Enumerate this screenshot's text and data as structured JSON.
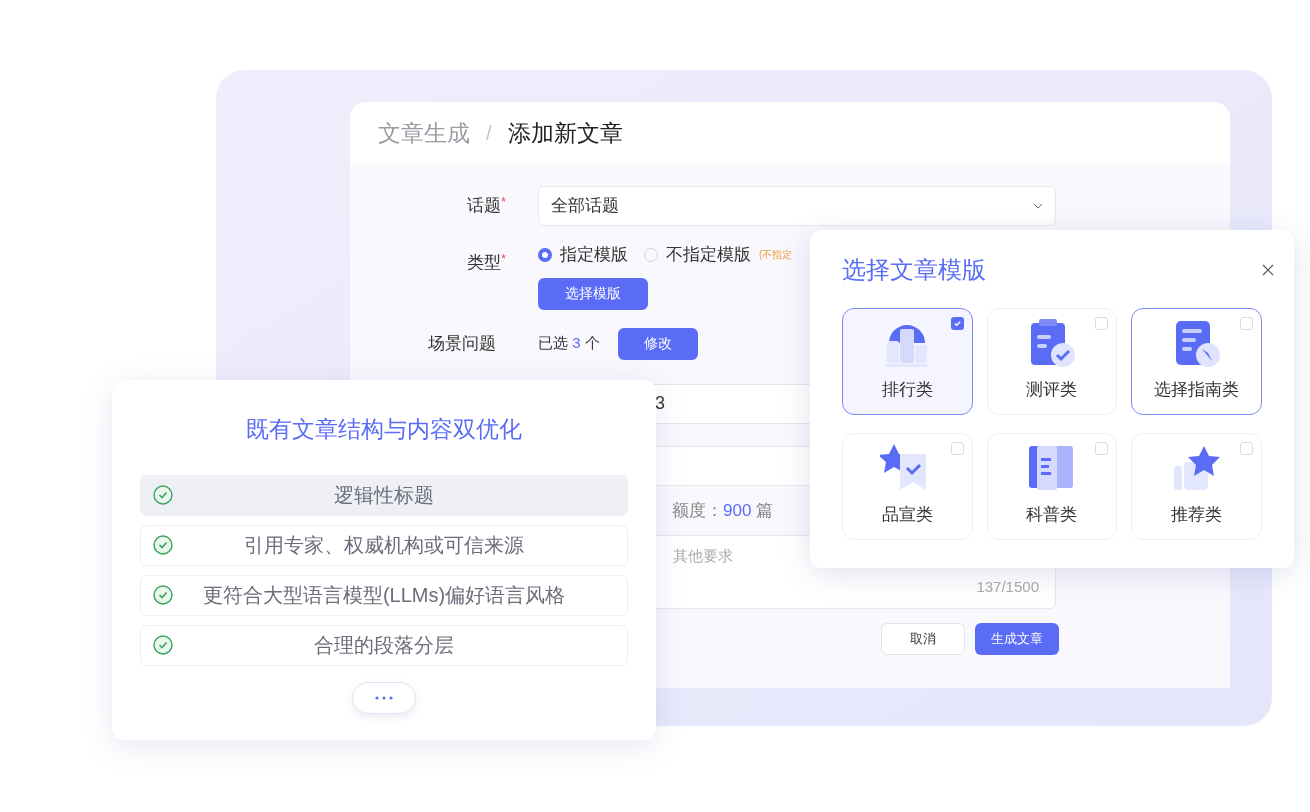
{
  "breadcrumb": {
    "parent": "文章生成",
    "separator": "/",
    "current": "添加新文章"
  },
  "form": {
    "topic": {
      "label": "话题",
      "required_mark": "*",
      "value": "全部话题"
    },
    "type": {
      "label": "类型",
      "required_mark": "*",
      "options": [
        {
          "label": "指定模版",
          "selected": true
        },
        {
          "label": "不指定模版",
          "selected": false
        }
      ],
      "hint": "(不指定",
      "button": "选择模版"
    },
    "scenario": {
      "label": "场景问题",
      "prefix": "已选",
      "count": "3",
      "suffix": "个",
      "button": "修改"
    },
    "field_1": {
      "value": "3"
    },
    "quota": {
      "label": "额度：",
      "value": "900",
      "unit": "篇"
    },
    "requirements": {
      "placeholder": "其他要求",
      "counter": "137/1500"
    },
    "buttons": [
      {
        "label": "取消",
        "kind": "secondary"
      },
      {
        "label": "生成文章",
        "kind": "primary"
      }
    ]
  },
  "feature_card": {
    "title": "既有文章结构与内容双优化",
    "items": [
      {
        "text": "逻辑性标题",
        "selected": true
      },
      {
        "text": "引用专家、权威机构或可信来源",
        "selected": false
      },
      {
        "text": "更符合大型语言模型(LLMs)偏好语言风格",
        "selected": false
      },
      {
        "text": "合理的段落分层",
        "selected": false
      }
    ]
  },
  "template_dialog": {
    "title": "选择文章模版",
    "templates": [
      {
        "label": "排行类",
        "kind": "ranking",
        "checked": true,
        "highlighted": true
      },
      {
        "label": "测评类",
        "kind": "review",
        "checked": false,
        "highlighted": false
      },
      {
        "label": "选择指南类",
        "kind": "guide",
        "checked": false,
        "highlighted": true
      },
      {
        "label": "品宣类",
        "kind": "brand",
        "checked": false,
        "highlighted": false
      },
      {
        "label": "科普类",
        "kind": "science",
        "checked": false,
        "highlighted": false
      },
      {
        "label": "推荐类",
        "kind": "recommend",
        "checked": false,
        "highlighted": false
      }
    ]
  }
}
